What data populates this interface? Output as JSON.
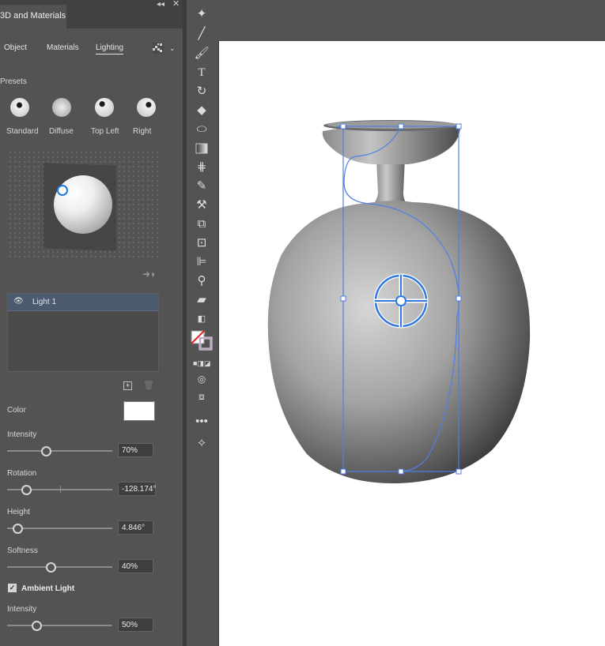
{
  "panel": {
    "title": "3D and Materials",
    "collapse_icon": "double-chevron-icon",
    "close_icon": "close-icon",
    "tabs": [
      "Object",
      "Materials",
      "Lighting"
    ],
    "active_tab": "Lighting",
    "render_icon": "render-icon"
  },
  "presets": {
    "label": "Presets",
    "items": [
      "Standard",
      "Diffuse",
      "Top Left",
      "Right"
    ]
  },
  "lights": {
    "items": [
      {
        "name": "Light 1",
        "visible": true
      }
    ],
    "add_icon": "add-icon",
    "delete_icon": "trash-icon",
    "move_icon": "move-light-icon"
  },
  "properties": {
    "color_label": "Color",
    "color_value": "#ffffff",
    "intensity_label": "Intensity",
    "intensity_value": "70%",
    "intensity_fraction": 0.7,
    "rotation_label": "Rotation",
    "rotation_value": "-128.174°",
    "height_label": "Height",
    "height_value": "4.846°",
    "softness_label": "Softness",
    "softness_value": "40%",
    "softness_fraction": 0.4
  },
  "ambient": {
    "label": "Ambient Light",
    "checked": true,
    "intensity_label": "Intensity",
    "intensity_value": "50%",
    "intensity_fraction": 0.5
  },
  "tools": [
    "magic-wand-icon",
    "line-icon",
    "paintbrush-icon",
    "type-icon",
    "lasso-icon",
    "eraser-icon",
    "warp-icon",
    "gradient-icon",
    "eyedropper-icon",
    "measure-icon",
    "puppet-warp-icon",
    "shape-builder-icon",
    "artboard-icon",
    "chart-icon",
    "zoom-icon",
    "fill-stroke-icon",
    "more-tools-icon"
  ],
  "canvas": {
    "selection_color": "#4f7fe6",
    "background": "#ffffff"
  }
}
